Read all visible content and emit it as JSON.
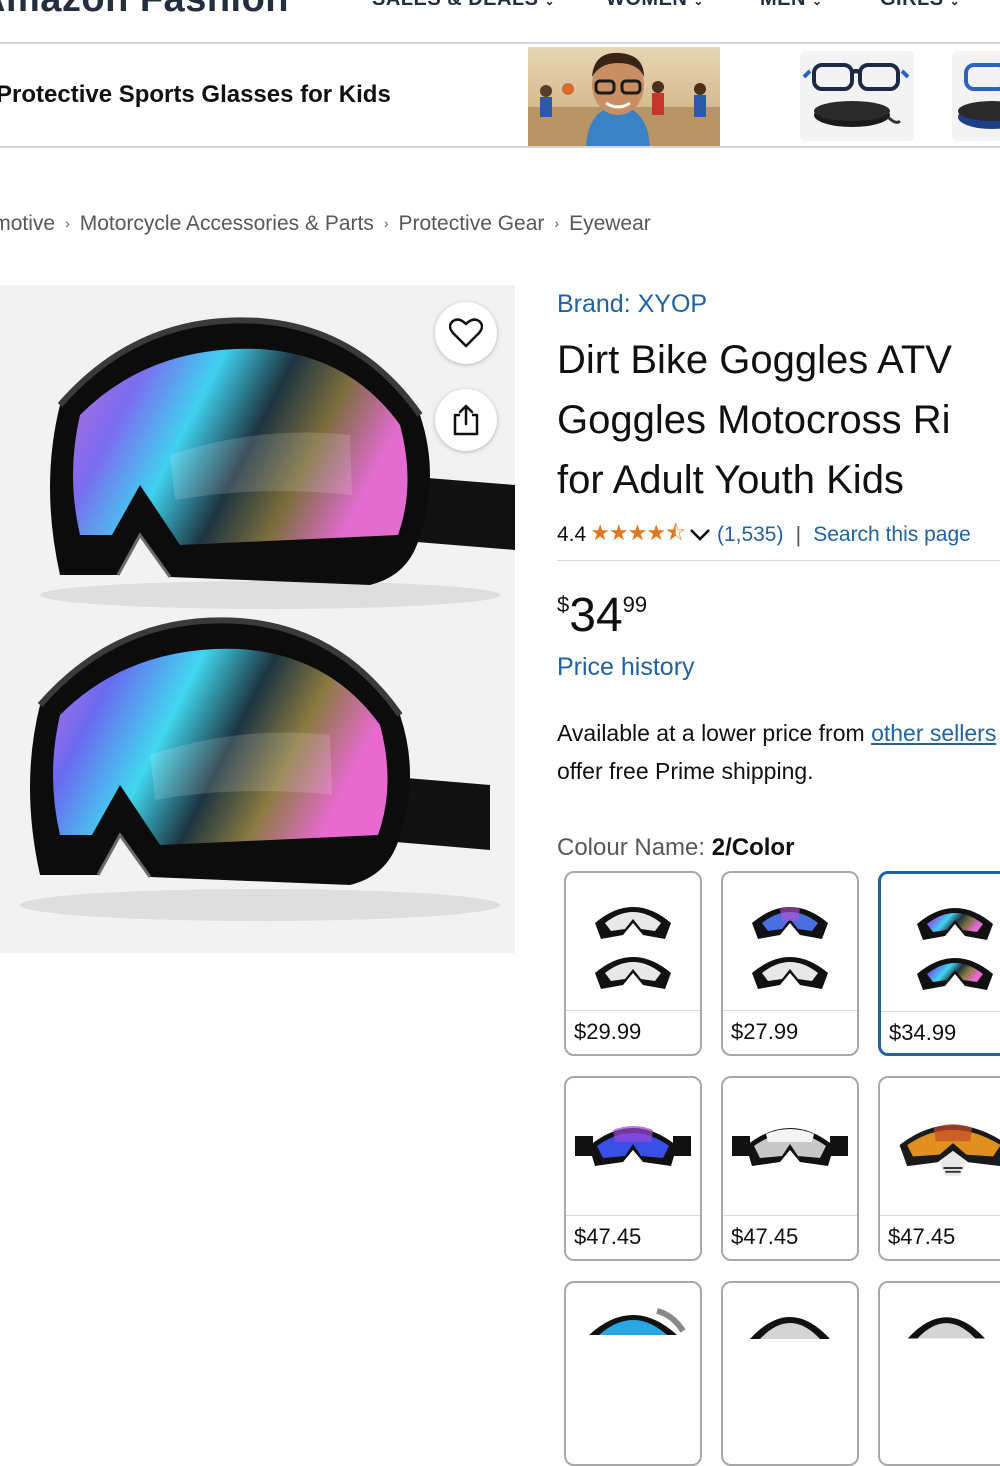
{
  "nav": {
    "store_name": "Amazon Fashion",
    "items": [
      {
        "label": "SALES & DEALS"
      },
      {
        "label": "WOMEN"
      },
      {
        "label": "MEN"
      },
      {
        "label": "GIRLS"
      }
    ]
  },
  "banner": {
    "text": "Protective Sports Glasses for Kids"
  },
  "breadcrumb": [
    "Automotive",
    "Motorcycle Accessories & Parts",
    "Protective Gear",
    "Eyewear"
  ],
  "product": {
    "brand": "Brand: XYOP",
    "title_lines": [
      "Dirt Bike Goggles ATV",
      "Goggles Motocross Ri",
      "for Adult Youth Kids"
    ],
    "rating_value": "4.4",
    "stars": "★★★★⯪",
    "rating_count": "(1,535)",
    "rating_sep": "|",
    "search_link": "Search this page",
    "price_symbol": "$",
    "price_whole": "34",
    "price_fraction": "99",
    "price_history": "Price history",
    "avail_pre": "Available at a lower price from ",
    "avail_link": "other sellers",
    "avail_post": "offer free Prime shipping.",
    "colour_label": "Colour Name:",
    "colour_value": "2/Color"
  },
  "swatches": [
    {
      "price": "$29.99",
      "icon": "clear-goggles-pair-icon"
    },
    {
      "price": "$27.99",
      "icon": "blue-and-clear-goggles-icon"
    },
    {
      "price": "$34.99",
      "icon": "iridescent-goggles-pair-icon",
      "selected": true
    },
    {
      "price": "$47.45",
      "icon": "blue-mirror-goggles-icon"
    },
    {
      "price": "$47.45",
      "icon": "silver-mirror-goggles-icon"
    },
    {
      "price": "$47.45",
      "icon": "orange-mirror-goggles-icon"
    }
  ],
  "colors": {
    "link": "#2162a1",
    "star": "#de7921",
    "selected_border": "#2162a1"
  }
}
